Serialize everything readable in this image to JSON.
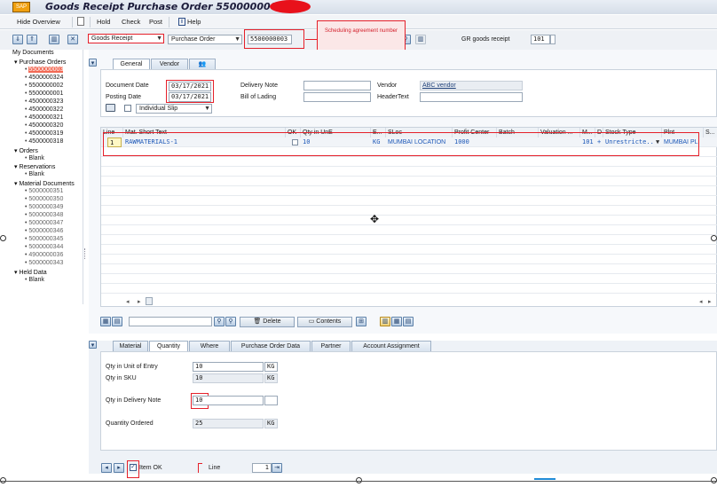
{
  "window": {
    "title": "Goods Receipt Purchase Order 5500000003 -",
    "app_icon": "sap-icon"
  },
  "menubar": {
    "items": [
      "Hide Overview",
      "Hold",
      "Check",
      "Post",
      "Help"
    ],
    "help_icon": "info-icon"
  },
  "toolbar": {
    "transaction": "Goods Receipt",
    "reference": "Purchase Order",
    "po_number": "5500000003",
    "gr_label": "GR goods receipt",
    "movement_type": "101",
    "annotation": "Scheduling agreement number"
  },
  "sidebar": {
    "title": "My Documents",
    "groups": [
      {
        "label": "Purchase Orders",
        "items": [
          "5500000003",
          "4500000324",
          "5500000002",
          "5500000001",
          "4500000323",
          "4500000322",
          "4500000321",
          "4500000320",
          "4500000319",
          "4500000318"
        ]
      },
      {
        "label": "Orders",
        "items": [
          "Blank"
        ]
      },
      {
        "label": "Reservations",
        "items": [
          "Blank"
        ]
      },
      {
        "label": "Material Documents",
        "items": [
          "5000000351",
          "5000000350",
          "5000000349",
          "5000000348",
          "5000000347",
          "5000000346",
          "5000000345",
          "5000000344",
          "4900000036",
          "5000000343"
        ]
      },
      {
        "label": "Held Data",
        "items": [
          "Blank"
        ]
      }
    ]
  },
  "header_tabs": [
    "General",
    "Vendor"
  ],
  "general": {
    "document_date_label": "Document Date",
    "document_date": "03/17/2021",
    "posting_date_label": "Posting Date",
    "posting_date": "03/17/2021",
    "delivery_note_label": "Delivery Note",
    "bill_of_lading_label": "Bill of Lading",
    "vendor_label": "Vendor",
    "vendor": "ABC vendor",
    "header_text_label": "HeaderText",
    "slip_option": "Individual Slip"
  },
  "grid": {
    "columns": [
      "Line",
      "Mat. Short Text",
      "OK",
      "Qty in UnE",
      "E...",
      "SLoc",
      "Profit Center",
      "Batch",
      "Valuation ...",
      "M...",
      "D",
      "Stock Type",
      "Plnt",
      "S..."
    ],
    "rows": [
      {
        "line": "1",
        "material": "RAWMATERIALS-1",
        "qty": "10",
        "unit": "KG",
        "sloc": "MUMBAI LOCATION",
        "profit_center": "1000",
        "movement": "101",
        "d": "+",
        "stock_type": "Unrestricte...",
        "plant": "MUMBAI PL"
      }
    ]
  },
  "grid_toolbar": {
    "delete_label": "Delete",
    "contents_label": "Contents"
  },
  "item_tabs": [
    "Material",
    "Quantity",
    "Where",
    "Purchase Order Data",
    "Partner",
    "Account Assignment"
  ],
  "quantity": {
    "qty_unit_entry_label": "Qty in Unit of Entry",
    "qty_unit_entry": "10",
    "qty_unit_entry_uom": "KG",
    "qty_sku_label": "Qty in SKU",
    "qty_sku": "10",
    "qty_sku_uom": "KG",
    "qty_delivery_note_label": "Qty in Delivery Note",
    "qty_delivery_note": "10",
    "qty_ordered_label": "Quantity Ordered",
    "qty_ordered": "25",
    "qty_ordered_uom": "KG"
  },
  "footer": {
    "item_ok_label": "Item OK",
    "line_label": "Line",
    "line_value": "1"
  },
  "colors": {
    "accent_red": "#e5202a",
    "selected_po": "#f26a55",
    "link_blue": "#1d58b8"
  }
}
